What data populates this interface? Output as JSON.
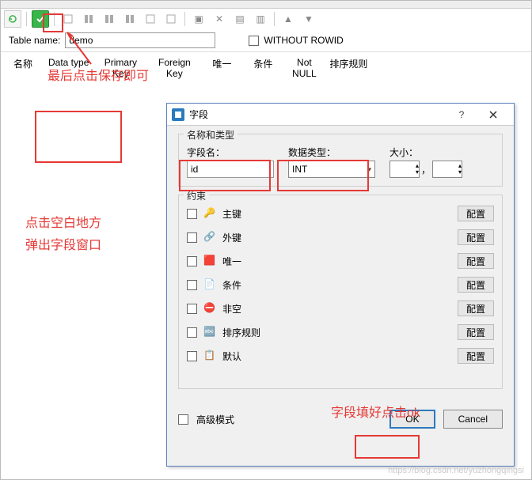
{
  "bg": {
    "table_name_label": "Table name:",
    "table_name_value": "demo",
    "without_rowid": "WITHOUT ROWID",
    "cols": {
      "c1": "名称",
      "c2": "Data type",
      "c3": "Primary Key",
      "c4": "Foreign Key",
      "c5": "唯一",
      "c6": "条件",
      "c7": "Not NULL",
      "c8": "排序规则"
    }
  },
  "annot": {
    "a1": "最后点击保存即可",
    "a2a": "点击空白地方",
    "a2b": "弹出字段窗口",
    "a3": "字段填好点击ok"
  },
  "dlg": {
    "title": "字段",
    "help": "?",
    "section1": "名称和类型",
    "field_name_label": "字段名：",
    "field_name_value": "id",
    "data_type_label": "数据类型：",
    "data_type_value": "INT",
    "size_label": "大小：",
    "comma": "，",
    "section2": "约束",
    "constraints": {
      "pk": "主键",
      "fk": "外键",
      "uq": "唯一",
      "ck": "条件",
      "nn": "非空",
      "co": "排序规则",
      "df": "默认"
    },
    "cfg": "配置",
    "adv": "高级模式",
    "ok": "OK",
    "cancel": "Cancel"
  },
  "watermark": "https://blog.csdn.net/yuzhongqingsi"
}
